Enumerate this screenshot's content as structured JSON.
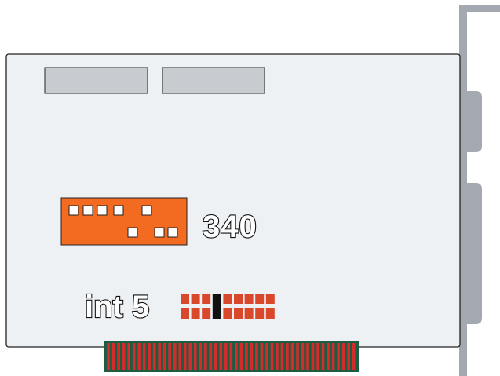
{
  "labels": {
    "address": "340",
    "irq": "int 5"
  },
  "dip_switch": {
    "switch_count": 8,
    "positions": [
      "up",
      "up",
      "up",
      "up",
      "off",
      "up",
      "down",
      "down",
      "down"
    ]
  },
  "irq_jumper": {
    "pin_pairs": 9,
    "selected_index": 3
  },
  "colors": {
    "board": "#edf1f4",
    "board_border": "#222222",
    "bracket": "#a4a8b0",
    "dip_body": "#f26b21",
    "jumper_pin": "#d9482b",
    "jumper_selected": "#111111",
    "edge_connector": "#1e5c41",
    "edge_contact": "#d42c2c",
    "connector_block": "#c8ccd0"
  }
}
